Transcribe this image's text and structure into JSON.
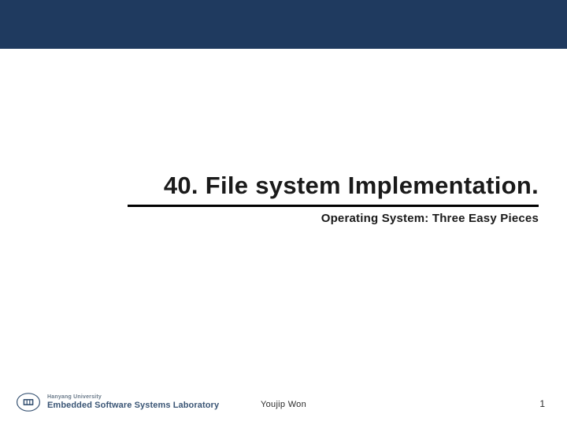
{
  "colors": {
    "topBar": "#1f3a5f",
    "text": "#1a1a1a",
    "labText": "#3a5575"
  },
  "title": "40. File system Implementation.",
  "subtitle": "Operating System: Three Easy Pieces",
  "footer": {
    "university": "Hanyang University",
    "lab": "Embedded Software Systems Laboratory",
    "author": "Youjip Won",
    "page": "1"
  }
}
